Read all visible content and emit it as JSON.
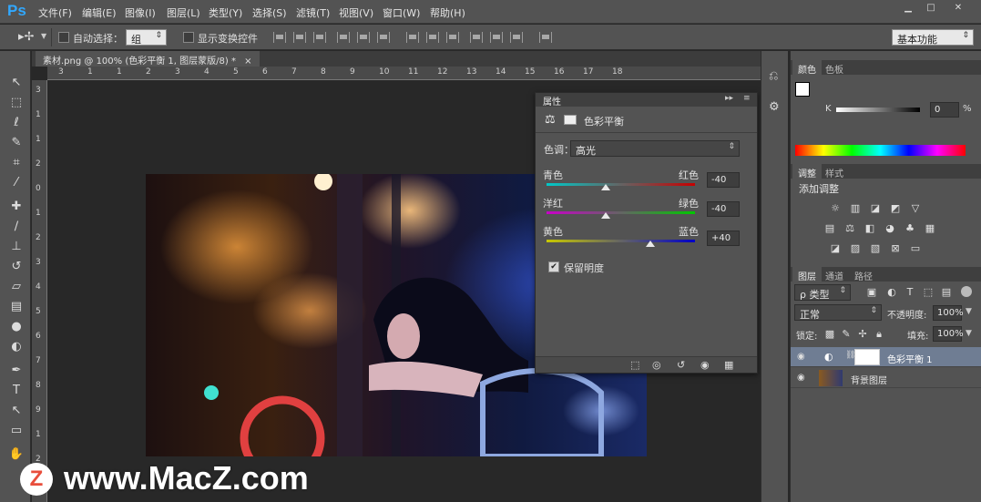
{
  "app": {
    "logo": "Ps"
  },
  "menu": [
    "文件(F)",
    "编辑(E)",
    "图像(I)",
    "图层(L)",
    "类型(Y)",
    "选择(S)",
    "滤镜(T)",
    "视图(V)",
    "窗口(W)",
    "帮助(H)"
  ],
  "window_controls": {
    "minimize": "▁",
    "maximize": "□",
    "close": "✕"
  },
  "options": {
    "auto_select_label": "自动选择：",
    "auto_select_value": "组",
    "show_transform_label": "显示变换控件",
    "workspace": "基本功能"
  },
  "document": {
    "tab_title": "素材.png @ 100% (色彩平衡 1, 图层蒙版/8) *",
    "tab_close": "×"
  },
  "ruler_top": [
    "3",
    "1",
    "1",
    "2",
    "3",
    "4",
    "5",
    "6",
    "7",
    "8",
    "9",
    "10",
    "11",
    "12",
    "13",
    "14",
    "15",
    "16",
    "17",
    "18"
  ],
  "ruler_left": [
    "3",
    "1",
    "1",
    "2",
    "0",
    "1",
    "2",
    "3",
    "4",
    "5",
    "6",
    "7",
    "8",
    "9",
    "1",
    "2"
  ],
  "properties": {
    "tab": "属性",
    "title": "色彩平衡",
    "tone_label": "色调：",
    "tone_value": "高光",
    "sliders": [
      {
        "left": "青色",
        "right": "红色",
        "value": "-40",
        "level": 0.4,
        "track": "linear-gradient(90deg,#00c8c8,#c80000)"
      },
      {
        "left": "洋红",
        "right": "绿色",
        "value": "-40",
        "level": 0.4,
        "track": "linear-gradient(90deg,#c800c8,#00c800)"
      },
      {
        "left": "黄色",
        "right": "蓝色",
        "value": "+40",
        "level": 0.7,
        "track": "linear-gradient(90deg,#c8c800,#0000c8)"
      }
    ],
    "preserve_label": "保留明度",
    "preserve_checked": "✔"
  },
  "color_panel": {
    "tabs": [
      "颜色",
      "色板"
    ],
    "k_label": "K",
    "k_value": "0",
    "k_unit": "%"
  },
  "adjust_panel": {
    "tabs": [
      "调整",
      "样式"
    ],
    "title": "添加调整"
  },
  "layers_panel": {
    "tabs": [
      "图层",
      "通道",
      "路径"
    ],
    "filter_value": "ρ 类型",
    "blend_mode": "正常",
    "opacity_label": "不透明度:",
    "opacity_value": "100%",
    "lock_label": "锁定:",
    "fill_label": "填充:",
    "fill_value": "100%",
    "layers": [
      {
        "name": "色彩平衡 1",
        "selected": true
      },
      {
        "name": "背景图层",
        "selected": false
      }
    ]
  },
  "watermark": {
    "logo": "Z",
    "text": "www.MacZ.com"
  }
}
